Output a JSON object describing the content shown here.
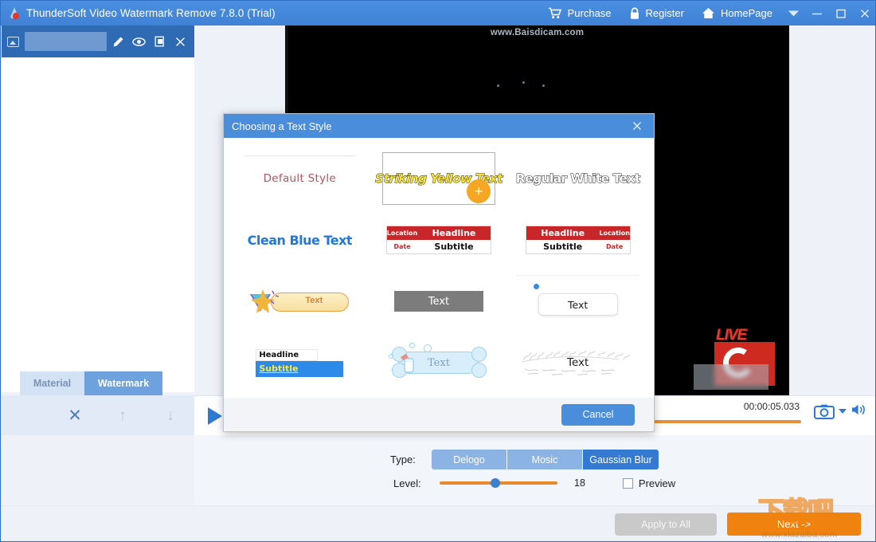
{
  "titlebar": {
    "app_title": "ThunderSoft Video Watermark Remove 7.8.0 (Trial)",
    "logo_icon": "water-drop-icon",
    "menu": [
      {
        "label": "Purchase",
        "icon": "shopping-cart-icon"
      },
      {
        "label": "Register",
        "icon": "lock-icon"
      },
      {
        "label": "HomePage",
        "icon": "home-icon"
      }
    ],
    "system": [
      {
        "name": "dropdown-icon",
        "glyph": "▼"
      },
      {
        "name": "minimize-icon",
        "glyph": "—"
      },
      {
        "name": "maximize-icon",
        "glyph": "□"
      },
      {
        "name": "close-icon",
        "glyph": "✕"
      }
    ]
  },
  "left_panel": {
    "thumbnail_icon": "image-thumbnail-icon",
    "tools": [
      {
        "name": "edit-icon",
        "label": "Edit"
      },
      {
        "name": "eye-icon",
        "label": "Preview"
      },
      {
        "name": "copy-icon",
        "label": "Copy"
      },
      {
        "name": "close-icon",
        "label": "Remove"
      }
    ],
    "tabs": [
      {
        "label": "Material",
        "active": false
      },
      {
        "label": "Watermark",
        "active": true
      }
    ],
    "actions": [
      {
        "name": "delete-icon",
        "glyph": "✕"
      },
      {
        "name": "move-up-icon",
        "glyph": "↑"
      },
      {
        "name": "move-down-icon",
        "glyph": "↓"
      }
    ]
  },
  "preview": {
    "video_watermark_text": "www.Baisdicam.com",
    "live_badge_text": "LIVE"
  },
  "playbar": {
    "play_icon": "play-icon",
    "timecode": "00:00:05.033",
    "snapshot_icon": "camera-icon",
    "snapshot_caret_icon": "chevron-down-icon",
    "volume_icon": "speaker-icon"
  },
  "settings": {
    "type_label": "Type:",
    "type_options": [
      {
        "label": "Delogo",
        "active": false
      },
      {
        "label": "Mosic",
        "active": false
      },
      {
        "label": "Gaussian Blur",
        "active": true
      }
    ],
    "level_label": "Level:",
    "level_value": "18",
    "level_percent": 45,
    "preview_label": "Preview",
    "preview_checked": false
  },
  "footer": {
    "apply_to_all_label": "Apply to All",
    "apply_to_all_enabled": false,
    "next_label": "Next ->"
  },
  "site_watermark": {
    "cn_text": "下载吧",
    "url_text": "www.xiazaiba.com"
  },
  "dialog": {
    "title": "Choosing a Text Style",
    "close_icon": "close-icon",
    "cancel_label": "Cancel",
    "styles": [
      {
        "id": "default-style",
        "kind": "plain",
        "text": "Default Style",
        "selected": false
      },
      {
        "id": "striking-yellow-text",
        "kind": "outlined-yellow",
        "text": "Striking Yellow Text",
        "selected": true,
        "badge": "+"
      },
      {
        "id": "regular-white-text",
        "kind": "outlined-white",
        "text": "Regular White Text",
        "selected": false
      },
      {
        "id": "clean-blue-text",
        "kind": "plain-blue",
        "text": "Clean Blue Text",
        "selected": false
      },
      {
        "id": "news-lower-third-left",
        "kind": "news-left",
        "location": "Location",
        "headline": "Headline",
        "date": "Date",
        "subtitle": "Subtitle",
        "selected": false
      },
      {
        "id": "news-lower-third-right",
        "kind": "news-right",
        "location": "Location",
        "headline": "Headline",
        "date": "Date",
        "subtitle": "Subtitle",
        "selected": false
      },
      {
        "id": "ribbon-badge-text",
        "kind": "ribbon",
        "text": "Text",
        "selected": false
      },
      {
        "id": "gray-box-text",
        "kind": "graybox",
        "text": "Text",
        "selected": false
      },
      {
        "id": "dot-card-text",
        "kind": "dotcard",
        "text": "Text",
        "selected": false
      },
      {
        "id": "headline-subtitle-bar",
        "kind": "headsub",
        "headline": "Headline",
        "subtitle": "Subtitle",
        "selected": false
      },
      {
        "id": "bone-bubble-text",
        "kind": "bone",
        "text": "Text",
        "selected": false
      },
      {
        "id": "grass-sketch-text",
        "kind": "grass",
        "text": "Text",
        "selected": false
      }
    ]
  },
  "colors": {
    "titlebar_blue": "#4a8fe0",
    "dialog_blue": "#4a8ddb",
    "accent_orange": "#f0820f",
    "slider_orange": "#e8892b",
    "active_segment": "#357ad2",
    "tab_active": "#6ea2df"
  }
}
